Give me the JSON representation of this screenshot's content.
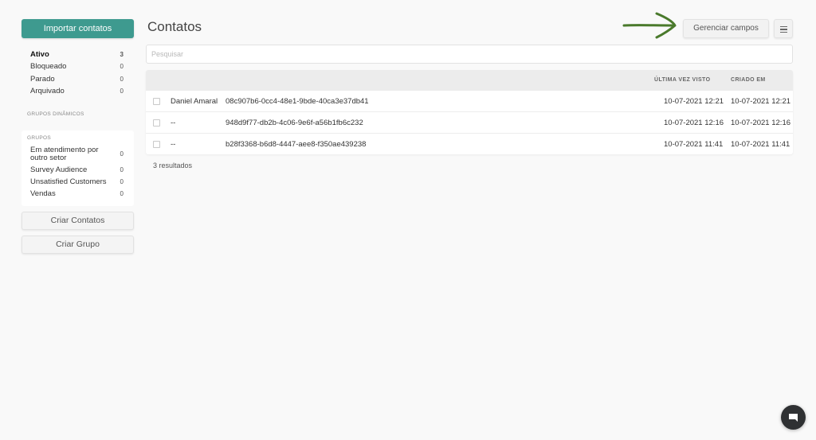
{
  "sidebar": {
    "import_label": "Importar contatos",
    "status": [
      {
        "label": "Ativo",
        "count": "3"
      },
      {
        "label": "Bloqueado",
        "count": "0"
      },
      {
        "label": "Parado",
        "count": "0"
      },
      {
        "label": "Arquivado",
        "count": "0"
      }
    ],
    "dynamic_groups_title": "GRUPOS DINÂMICOS",
    "groups_title": "GRUPOS",
    "groups": [
      {
        "label": "Em atendimento por outro setor",
        "count": "0"
      },
      {
        "label": "Survey Audience",
        "count": "0"
      },
      {
        "label": "Unsatisfied Customers",
        "count": "0"
      },
      {
        "label": "Vendas",
        "count": "0"
      }
    ],
    "create_contacts_label": "Criar Contatos",
    "create_group_label": "Criar Grupo"
  },
  "header": {
    "title": "Contatos",
    "manage_fields_label": "Gerenciar campos"
  },
  "search": {
    "placeholder": "Pesquisar"
  },
  "table": {
    "columns": [
      "ÚLTIMA VEZ VISTO",
      "CRIADO EM"
    ],
    "rows": [
      {
        "name": "Daniel Amaral",
        "id": "08c907b6-0cc4-48e1-9bde-40ca3e37db41",
        "last_seen": "10-07-2021 12:21",
        "created": "10-07-2021 12:21"
      },
      {
        "name": "--",
        "id": "948d9f77-db2b-4c06-9e6f-a56b1fb6c232",
        "last_seen": "10-07-2021 12:16",
        "created": "10-07-2021 12:16"
      },
      {
        "name": "--",
        "id": "b28f3368-b6d8-4447-aee8-f350ae439238",
        "last_seen": "10-07-2021 11:41",
        "created": "10-07-2021 11:41"
      }
    ]
  },
  "results_label": "3 resultados",
  "colors": {
    "accent": "#3e9a8f",
    "annotation_arrow": "#4a7a2c",
    "chat_button": "#2f3133"
  },
  "icons": {
    "menu": "hamburger-icon",
    "chat": "chat-icon",
    "annotation": "arrow-annotation"
  }
}
